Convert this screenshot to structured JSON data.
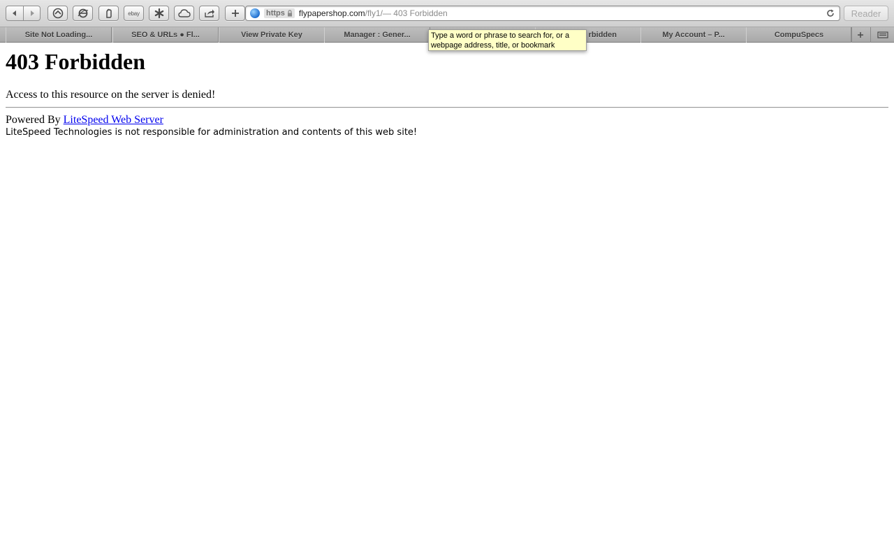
{
  "toolbar": {
    "ebay_label": "ebay",
    "address": {
      "scheme": "https",
      "host": "flypapershop.com",
      "path": "/fly1/",
      "page_title": " — 403 Forbidden"
    },
    "reader_label": "Reader"
  },
  "tabs": [
    {
      "label": "Site Not Loading..."
    },
    {
      "label": "SEO & URLs ● Fl..."
    },
    {
      "label": "View Private Key"
    },
    {
      "label": "Manager : Gener..."
    },
    {
      "label": "rbidden"
    },
    {
      "label": "My Account – P..."
    },
    {
      "label": "CompuSpecs"
    }
  ],
  "tooltip": {
    "line1": "Type a word or phrase to search for, or a",
    "line2": "webpage address, title, or bookmark"
  },
  "page": {
    "heading": "403 Forbidden",
    "message": "Access to this resource on the server is denied!",
    "powered_prefix": "Powered By ",
    "powered_link": "LiteSpeed Web Server",
    "disclaimer": "LiteSpeed Technologies is not responsible for administration and contents of this web site!"
  },
  "colors": {
    "link": "#0000ee",
    "tooltip_bg": "#ffffc6"
  }
}
